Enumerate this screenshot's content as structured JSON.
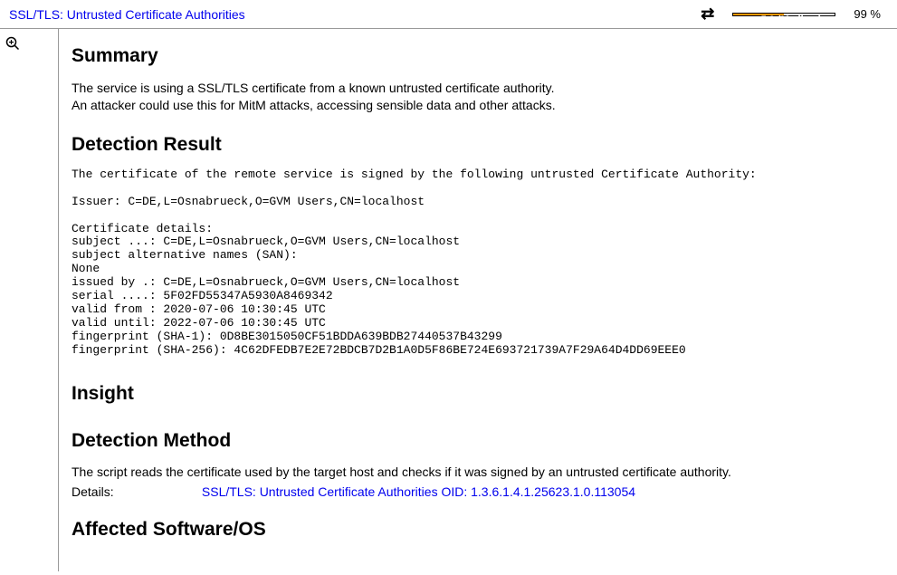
{
  "header": {
    "title": "SSL/TLS: Untrusted Certificate Authorities",
    "severity_label": "5.0 (Medium)",
    "percent": "99 %"
  },
  "sections": {
    "summary": {
      "heading": "Summary",
      "line1": "The service is using a SSL/TLS certificate from a known untrusted certificate authority.",
      "line2": "An attacker could use this for MitM attacks, accessing sensible data and other attacks."
    },
    "detection_result": {
      "heading": "Detection Result",
      "body": "The certificate of the remote service is signed by the following untrusted Certificate Authority:\n\nIssuer: C=DE,L=Osnabrueck,O=GVM Users,CN=localhost\n\nCertificate details:\nsubject ...: C=DE,L=Osnabrueck,O=GVM Users,CN=localhost\nsubject alternative names (SAN):\nNone\nissued by .: C=DE,L=Osnabrueck,O=GVM Users,CN=localhost\nserial ....: 5F02FD55347A5930A8469342\nvalid from : 2020-07-06 10:30:45 UTC\nvalid until: 2022-07-06 10:30:45 UTC\nfingerprint (SHA-1): 0D8BE3015050CF51BDDA639BDB27440537B43299\nfingerprint (SHA-256): 4C62DFEDB7E2E72BDCB7D2B1A0D5F86BE724E693721739A7F29A64D4DD69EEE0"
    },
    "insight": {
      "heading": "Insight"
    },
    "detection_method": {
      "heading": "Detection Method",
      "text": "The script reads the certificate used by the target host and checks if it was signed by an untrusted certificate authority.",
      "details_label": "Details:",
      "details_link": "SSL/TLS: Untrusted Certificate Authorities OID: 1.3.6.1.4.1.25623.1.0.113054"
    },
    "affected": {
      "heading": "Affected Software/OS"
    }
  }
}
